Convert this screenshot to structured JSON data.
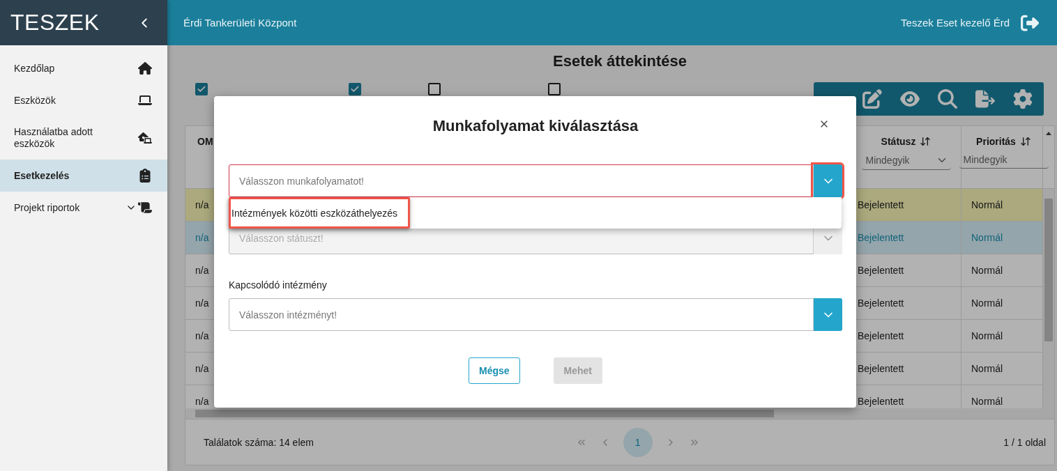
{
  "sidebar": {
    "brand": "TESZEK",
    "items": [
      {
        "label": "Kezdőlap",
        "selected": false,
        "expandable": false
      },
      {
        "label": "Eszközök",
        "selected": false,
        "expandable": false
      },
      {
        "label": "Használatba adott eszközök",
        "selected": false,
        "expandable": false
      },
      {
        "label": "Esetkezelés",
        "selected": true,
        "expandable": false
      },
      {
        "label": "Projekt riportok",
        "selected": false,
        "expandable": true
      }
    ]
  },
  "topbar": {
    "organization": "Érdi Tankerületi Központ",
    "user": "Teszek Eset kezelő Érd"
  },
  "page": {
    "title": "Esetek áttekintése",
    "filters": [
      {
        "checked": true
      },
      {
        "checked": true
      },
      {
        "checked": false
      },
      {
        "checked": false
      }
    ]
  },
  "table": {
    "columns": [
      {
        "label": "OM",
        "sortable": false
      },
      {
        "label": "Státusz",
        "sortable": true,
        "filter": "Mindegyik"
      },
      {
        "label": "Prioritás",
        "sortable": true,
        "filter": "Mindegyik"
      }
    ],
    "rows": [
      {
        "cells": [
          "n/a",
          "Bejelentett",
          "Normál"
        ],
        "selected": false,
        "kind": "highlighted"
      },
      {
        "cells": [
          "n/a",
          "Bejelentett",
          "Normál"
        ],
        "selected": true,
        "kind": "plain"
      },
      {
        "cells": [
          "n/a",
          "Bejelentett",
          "Normál"
        ],
        "selected": false,
        "kind": "plain"
      },
      {
        "cells": [
          "n/a",
          "Bejelentett",
          "Normál"
        ],
        "selected": false,
        "kind": "plain"
      },
      {
        "cells": [
          "n/a",
          "Bejelentett",
          "Normál"
        ],
        "selected": false,
        "kind": "plain"
      },
      {
        "cells": [
          "n/a",
          "Bejelentett",
          "Normál"
        ],
        "selected": false,
        "kind": "plain"
      },
      {
        "cells": [
          "n/a",
          "Bejelentett",
          "Normál"
        ],
        "selected": false,
        "kind": "plain"
      }
    ],
    "footer": {
      "count": "Találatok száma: 14 elem",
      "pages": [
        {
          "label": "1",
          "selected": true
        }
      ],
      "page_info": "1 / 1 oldal"
    }
  },
  "modal": {
    "title": "Munkafolyamat kiválasztása",
    "fields": [
      {
        "placeholder": "Válasszon munkafolyamatot!",
        "invalid": true,
        "disabled": false,
        "annotated": true,
        "options": [
          {
            "label": "Intézmények közötti eszközáthelyezés",
            "annotated": true
          }
        ]
      },
      {
        "placeholder": "Válasszon státuszt!",
        "invalid": false,
        "disabled": true,
        "annotated": false
      },
      {
        "label": "Kapcsolódó intézmény",
        "placeholder": "Válasszon intézményt!",
        "invalid": false,
        "disabled": false,
        "annotated": false
      }
    ],
    "buttons": [
      {
        "label": "Mégse",
        "disabled": false
      },
      {
        "label": "Mehet",
        "disabled": true
      }
    ]
  }
}
